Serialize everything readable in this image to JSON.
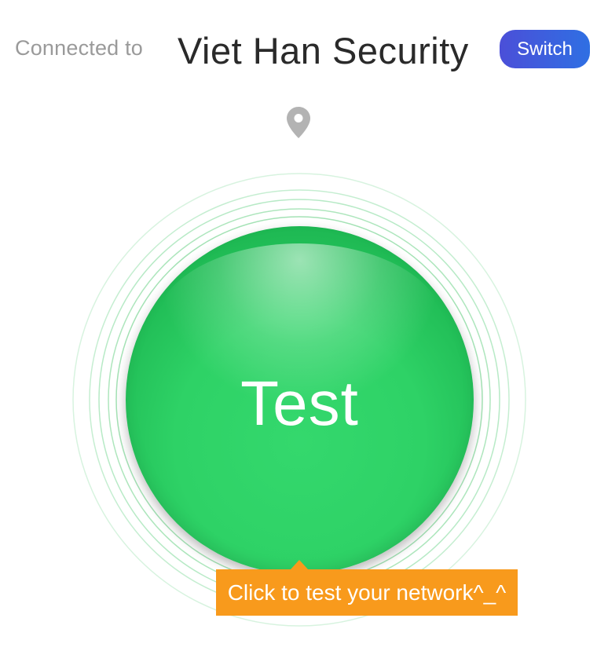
{
  "header": {
    "connected_label": "Connected to",
    "server_name": "Viet Han Security",
    "switch_label": "Switch"
  },
  "main": {
    "test_label": "Test",
    "tooltip": "Click to test your network^_^"
  },
  "icons": {
    "location": "location-pin-icon"
  },
  "colors": {
    "switch_button": "#3d5fe0",
    "test_button": "#2ed266",
    "tooltip": "#f89a1c",
    "ring": "#9be3b0"
  }
}
